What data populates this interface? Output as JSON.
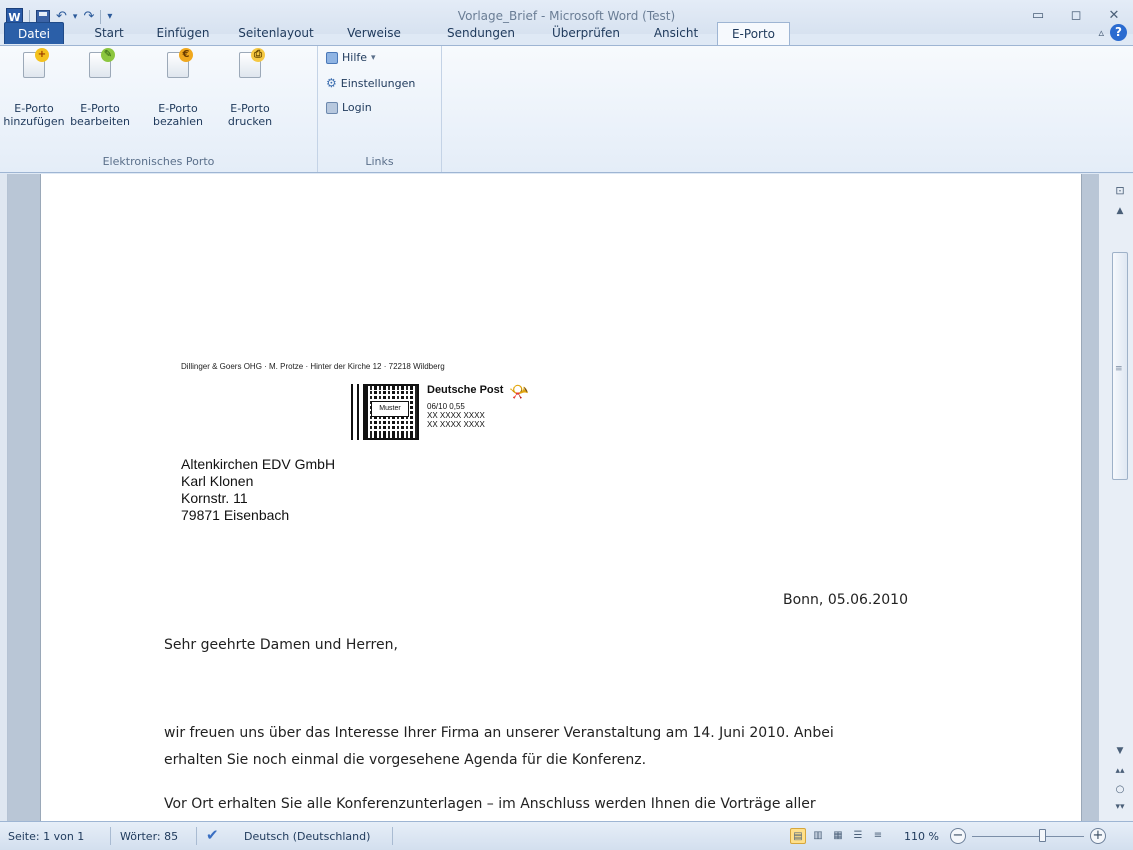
{
  "window": {
    "title": "Vorlage_Brief - Microsoft Word (Test)",
    "app_logo": "W",
    "controls": [
      "minimize-icon",
      "restore-icon",
      "close-icon"
    ]
  },
  "tabs": [
    {
      "label": "Datei"
    },
    {
      "label": "Start"
    },
    {
      "label": "Einfügen"
    },
    {
      "label": "Seitenlayout"
    },
    {
      "label": "Verweise"
    },
    {
      "label": "Sendungen"
    },
    {
      "label": "Überprüfen"
    },
    {
      "label": "Ansicht"
    },
    {
      "label": "E-Porto"
    }
  ],
  "ribbon": {
    "group1": {
      "label": "Elektronisches Porto",
      "buttons": [
        {
          "label1": "E-Porto",
          "label2": "hinzufügen",
          "icon": "add-stamp-icon"
        },
        {
          "label1": "E-Porto",
          "label2": "bearbeiten",
          "icon": "edit-stamp-icon"
        },
        {
          "label1": "E-Porto",
          "label2": "bezahlen",
          "icon": "pay-stamp-icon"
        },
        {
          "label1": "E-Porto",
          "label2": "drucken",
          "icon": "print-stamp-icon"
        }
      ]
    },
    "group2": {
      "label": "Links",
      "items": [
        {
          "label": "Hilfe",
          "dropdown": "▾"
        },
        {
          "label": "Einstellungen"
        },
        {
          "label": "Login"
        }
      ]
    }
  },
  "document": {
    "sender_line": "Dillinger & Goers OHG · M. Protze · Hinter der Kirche 12 · 72218 Wildberg",
    "stamp": {
      "brand": "Deutsche Post",
      "muster": "Muster",
      "line1": "06/10        0,55",
      "line2": "XX  XXXX  XXXX",
      "line3": "XX  XXXX  XXXX"
    },
    "recipient": [
      "Altenkirchen EDV GmbH",
      "Karl Klonen",
      "Kornstr. 11",
      "79871 Eisenbach"
    ],
    "date": "Bonn, 05.06.2010",
    "salutation": "Sehr geehrte Damen und Herren,",
    "para1_line1": "wir freuen uns über das Interesse Ihrer Firma an unserer Veranstaltung am 14. Juni 2010. Anbei",
    "para1_line2": "erhalten Sie noch einmal die vorgesehene Agenda für die Konferenz.",
    "para2_line1": "Vor Ort erhalten Sie alle Konferenzunterlagen – im Anschluss werden Ihnen die Vorträge aller"
  },
  "statusbar": {
    "page": "Seite: 1 von 1",
    "words": "Wörter: 85",
    "language": "Deutsch (Deutschland)",
    "zoom": "110 %",
    "zoom_minus": "−",
    "zoom_plus": "+"
  }
}
